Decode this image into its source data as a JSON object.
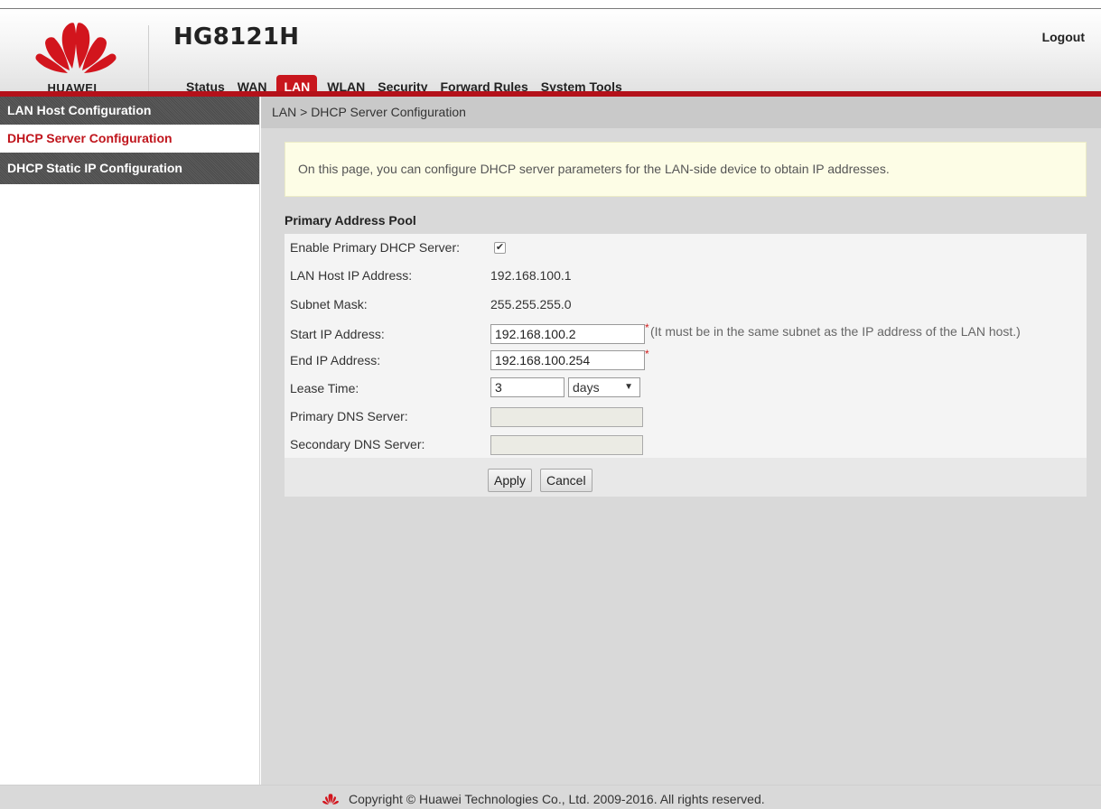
{
  "brand": {
    "logo_text": "HUAWEI",
    "model": "HG8121H",
    "logout": "Logout",
    "accent": "#c8161d"
  },
  "nav": {
    "items": [
      {
        "label": "Status"
      },
      {
        "label": "WAN"
      },
      {
        "label": "LAN",
        "active": true
      },
      {
        "label": "WLAN"
      },
      {
        "label": "Security"
      },
      {
        "label": "Forward Rules"
      },
      {
        "label": "System Tools"
      }
    ]
  },
  "sidebar": {
    "group": "LAN Host Configuration",
    "items": [
      {
        "label": "DHCP Server Configuration",
        "active": true
      },
      {
        "label": "DHCP Static IP Configuration"
      }
    ]
  },
  "main": {
    "breadcrumb": "LAN > DHCP Server Configuration",
    "notice": "On this page, you can configure DHCP server parameters for the LAN-side device to obtain IP addresses.",
    "section_title": "Primary Address Pool",
    "form": {
      "enable_label": "Enable Primary DHCP Server:",
      "enable_checked": true,
      "lan_ip_label": "LAN Host IP Address:",
      "lan_ip_value": "192.168.100.1",
      "mask_label": "Subnet Mask:",
      "mask_value": "255.255.255.0",
      "start_label": "Start IP Address:",
      "start_value": "192.168.100.2",
      "start_required": "*",
      "start_hint": "(It must be in the same subnet as the IP address of the LAN host.)",
      "end_label": "End IP Address:",
      "end_value": "192.168.100.254",
      "end_required": "*",
      "lease_label": "Lease Time:",
      "lease_value": "3",
      "lease_unit": "days",
      "dns1_label": "Primary DNS Server:",
      "dns1_value": "",
      "dns2_label": "Secondary DNS Server:",
      "dns2_value": ""
    },
    "buttons": {
      "apply": "Apply",
      "cancel": "Cancel"
    }
  },
  "footer": {
    "copyright": "Copyright © Huawei Technologies Co., Ltd. 2009-2016. All rights reserved."
  }
}
